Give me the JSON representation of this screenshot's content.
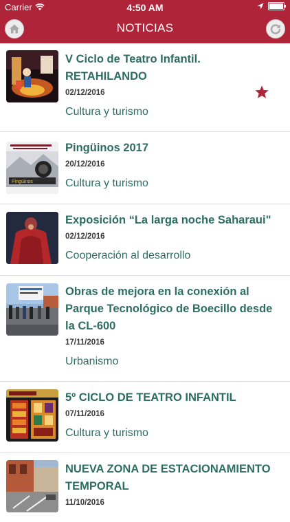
{
  "status_bar": {
    "carrier": "Carrier",
    "time": "4:50 AM",
    "battery_level": 1.0
  },
  "header": {
    "title": "NOTICIAS",
    "left_icon": "home-icon",
    "right_icon": "refresh-icon"
  },
  "colors": {
    "header_bg": "#b0243a",
    "title_text": "#2e6e62",
    "star": "#b0243a"
  },
  "news": [
    {
      "title": "V Ciclo de Teatro Infantil. RETAHILANDO",
      "date": "02/12/2016",
      "category": "Cultura y turismo",
      "favorite": true
    },
    {
      "title": "Pingüinos 2017",
      "date": "20/12/2016",
      "category": "Cultura y turismo",
      "favorite": false
    },
    {
      "title": "Exposición “La larga noche Saharaui\"",
      "date": "02/12/2016",
      "category": "Cooperación al desarrollo",
      "favorite": false
    },
    {
      "title": "Obras de mejora en la conexión al Parque Tecnológico de Boecillo desde la CL-600",
      "date": "17/11/2016",
      "category": "Urbanismo",
      "favorite": false
    },
    {
      "title": "5º CICLO DE TEATRO INFANTIL",
      "date": "07/11/2016",
      "category": "Cultura y turismo",
      "favorite": false
    },
    {
      "title": "NUEVA ZONA DE ESTACIONAMIENTO TEMPORAL",
      "date": "11/10/2016",
      "category": "",
      "favorite": false
    }
  ]
}
